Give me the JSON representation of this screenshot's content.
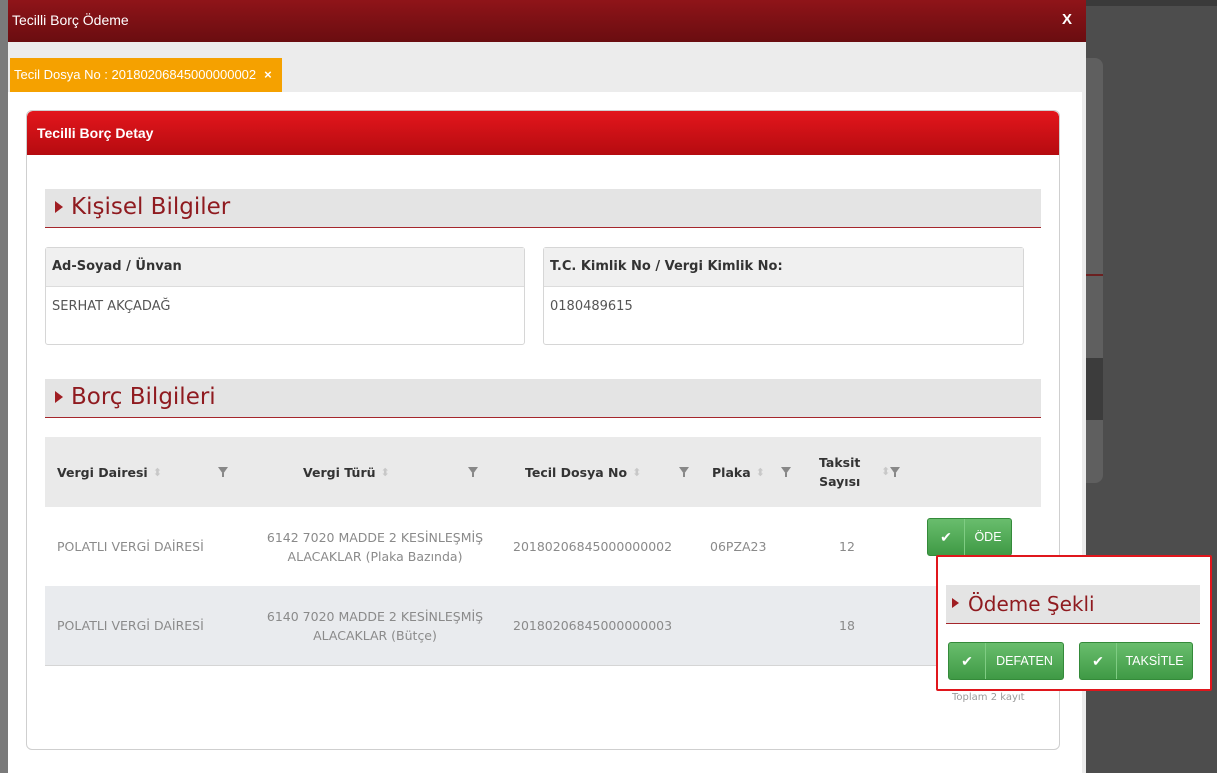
{
  "modal": {
    "title": "Tecilli Borç Ödeme",
    "close_label": "X"
  },
  "tab": {
    "label": "Tecil Dosya No : 20180206845000000002",
    "close_icon": "×"
  },
  "panel": {
    "title": "Tecilli Borç Detay"
  },
  "personal": {
    "section_title": "Kişisel Bilgiler",
    "name_label": "Ad-Soyad / Ünvan",
    "name_value": "SERHAT AKÇADAĞ",
    "id_label": "T.C. Kimlik No / Vergi Kimlik No:",
    "id_value": "0180489615"
  },
  "debt": {
    "section_title": "Borç Bilgileri",
    "columns": {
      "office": "Vergi Dairesi",
      "type": "Vergi Türü",
      "file": "Tecil Dosya No",
      "plate": "Plaka",
      "installment_line1": "Taksit",
      "installment_line2": "Sayısı"
    },
    "rows": [
      {
        "office": "POLATLI VERGİ DAİRESİ",
        "type_line1": "6142 7020 MADDE 2 KESİNLEŞMİŞ",
        "type_line2": "ALACAKLAR (Plaka Bazında)",
        "file": "20180206845000000002",
        "plate": "06PZA23",
        "installments": "12",
        "action": "ÖDE"
      },
      {
        "office": "POLATLI VERGİ DAİRESİ",
        "type_line1": "6140 7020 MADDE 2 KESİNLEŞMİŞ",
        "type_line2": "ALACAKLAR (Bütçe)",
        "file": "20180206845000000003",
        "plate": "",
        "installments": "18"
      }
    ],
    "total_text": "Toplam 2 kayıt"
  },
  "payment_popover": {
    "title": "Ödeme Şekli",
    "defaten": "DEFATEN",
    "taksitle": "TAKSİTLE"
  },
  "colors": {
    "header_dark_red": "#7a1014",
    "panel_red": "#d4141a",
    "tab_orange": "#f5a100",
    "button_green": "#4caf50",
    "popover_border": "#e0161c"
  }
}
